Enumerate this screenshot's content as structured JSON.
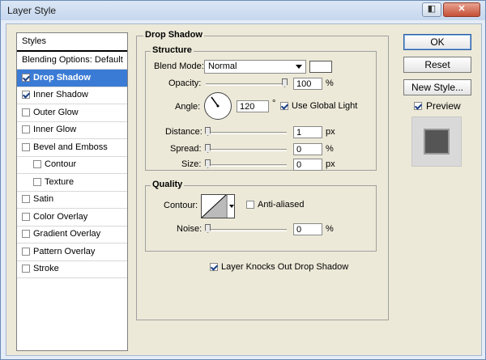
{
  "window": {
    "title": "Layer Style",
    "titlebar_buttons": [
      "◧",
      "✕"
    ]
  },
  "styles_list": {
    "header": "Styles",
    "items": [
      {
        "label": "Blending Options: Default",
        "checkbox": false,
        "checked": false,
        "indent": false,
        "selected": false
      },
      {
        "label": "Drop Shadow",
        "checkbox": true,
        "checked": true,
        "indent": false,
        "selected": true
      },
      {
        "label": "Inner Shadow",
        "checkbox": true,
        "checked": true,
        "indent": false,
        "selected": false
      },
      {
        "label": "Outer Glow",
        "checkbox": true,
        "checked": false,
        "indent": false,
        "selected": false
      },
      {
        "label": "Inner Glow",
        "checkbox": true,
        "checked": false,
        "indent": false,
        "selected": false
      },
      {
        "label": "Bevel and Emboss",
        "checkbox": true,
        "checked": false,
        "indent": false,
        "selected": false
      },
      {
        "label": "Contour",
        "checkbox": true,
        "checked": false,
        "indent": true,
        "selected": false
      },
      {
        "label": "Texture",
        "checkbox": true,
        "checked": false,
        "indent": true,
        "selected": false
      },
      {
        "label": "Satin",
        "checkbox": true,
        "checked": false,
        "indent": false,
        "selected": false
      },
      {
        "label": "Color Overlay",
        "checkbox": true,
        "checked": false,
        "indent": false,
        "selected": false
      },
      {
        "label": "Gradient Overlay",
        "checkbox": true,
        "checked": false,
        "indent": false,
        "selected": false
      },
      {
        "label": "Pattern Overlay",
        "checkbox": true,
        "checked": false,
        "indent": false,
        "selected": false
      },
      {
        "label": "Stroke",
        "checkbox": true,
        "checked": false,
        "indent": false,
        "selected": false
      }
    ]
  },
  "drop_shadow": {
    "title": "Drop Shadow",
    "structure": {
      "title": "Structure",
      "blend_mode_label": "Blend Mode:",
      "blend_mode_value": "Normal",
      "opacity_label": "Opacity:",
      "opacity_value": "100",
      "opacity_unit": "%",
      "angle_label": "Angle:",
      "angle_value": "120",
      "angle_unit": "°",
      "use_global_light_label": "Use Global Light",
      "use_global_light_checked": true,
      "distance_label": "Distance:",
      "distance_value": "1",
      "distance_unit": "px",
      "spread_label": "Spread:",
      "spread_value": "0",
      "spread_unit": "%",
      "size_label": "Size:",
      "size_value": "0",
      "size_unit": "px"
    },
    "quality": {
      "title": "Quality",
      "contour_label": "Contour:",
      "anti_aliased_label": "Anti-aliased",
      "anti_aliased_checked": false,
      "noise_label": "Noise:",
      "noise_value": "0",
      "noise_unit": "%"
    },
    "layer_knocks_out_label": "Layer Knocks Out Drop Shadow",
    "layer_knocks_out_checked": true
  },
  "buttons": {
    "ok": "OK",
    "reset": "Reset",
    "new_style": "New Style...",
    "preview_label": "Preview",
    "preview_checked": true
  }
}
